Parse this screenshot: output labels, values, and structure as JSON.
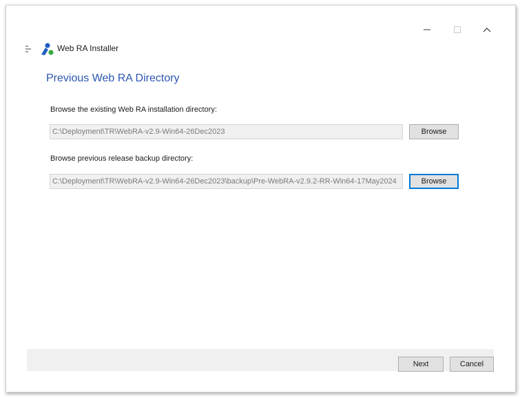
{
  "window": {
    "title": "Web RA Installer",
    "controls": {
      "minimize_icon": "minimize-icon",
      "maximize_icon": "maximize-icon",
      "collapse_icon": "chevron-up-icon"
    },
    "menu_icon": "hamburger-icon",
    "logo_icon": "web-ra-logo",
    "colors": {
      "accent": "#2b57b2",
      "focus": "#0078d7",
      "logo_blue": "#1f5fbf",
      "logo_green": "#3aa845"
    }
  },
  "page": {
    "title": "Previous Web RA Directory"
  },
  "form": {
    "existing_dir_label": "Browse the existing Web RA installation directory:",
    "existing_dir_value": "C:\\Deployment\\TR\\WebRA-v2.9-Win64-26Dec2023",
    "existing_browse_label": "Browse",
    "backup_dir_label": "Browse previous release backup directory:",
    "backup_dir_value": "C:\\Deployment\\TR\\WebRA-v2.9-Win64-26Dec2023\\backup\\Pre-WebRA-v2.9.2-RR-Win64-17May2024",
    "backup_browse_label": "Browse"
  },
  "footer": {
    "next_label": "Next",
    "cancel_label": "Cancel"
  }
}
